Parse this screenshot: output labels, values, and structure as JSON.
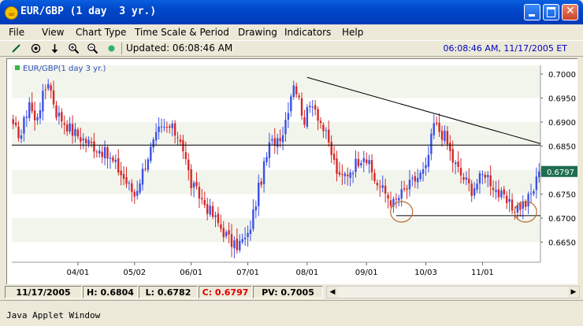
{
  "window": {
    "title": "EUR/GBP (1 day  3 yr.)",
    "app_icon": "java-coffee-icon"
  },
  "menu": [
    "File",
    "View",
    "Chart Type",
    "Time Scale & Period",
    "Drawing",
    "Indicators",
    "Help"
  ],
  "toolbar": {
    "icons": [
      "draw-line-icon",
      "crosshair-icon",
      "down-arrow-icon",
      "zoom-in-icon",
      "zoom-out-icon",
      "status-dot-icon"
    ],
    "updated": "Updated: 06:08:46 AM",
    "timestamp": "06:08:46 AM, 11/17/2005 ET"
  },
  "chart_data": {
    "type": "candlestick",
    "title": "EUR/GBP(1 day  3 yr.)",
    "y_ticks": [
      "0.7000",
      "0.6950",
      "0.6900",
      "0.6850",
      "0.6800",
      "0.6750",
      "0.6700",
      "0.6650"
    ],
    "y_tick_values": [
      0.7,
      0.695,
      0.69,
      0.685,
      0.68,
      0.675,
      0.67,
      0.665
    ],
    "x_ticks": [
      "04/01",
      "05/02",
      "06/01",
      "07/01",
      "08/01",
      "09/01",
      "10/03",
      "11/01"
    ],
    "x_tick_index": [
      24,
      45,
      66,
      87,
      109,
      131,
      153,
      174
    ],
    "ylim": [
      0.6608,
      0.7018
    ],
    "bar_count": 196,
    "current_price": "0.6797",
    "current_value": 0.6797,
    "up_color": "#3A50E8",
    "down_color": "#D52828",
    "anchors": [
      [
        0,
        0.6885
      ],
      [
        3,
        0.6875
      ],
      [
        6,
        0.6945
      ],
      [
        8,
        0.69
      ],
      [
        13,
        0.6988
      ],
      [
        16,
        0.692
      ],
      [
        22,
        0.688
      ],
      [
        27,
        0.686
      ],
      [
        33,
        0.684
      ],
      [
        38,
        0.681
      ],
      [
        45,
        0.6748
      ],
      [
        50,
        0.683
      ],
      [
        54,
        0.688
      ],
      [
        58,
        0.6888
      ],
      [
        62,
        0.6868
      ],
      [
        66,
        0.677
      ],
      [
        71,
        0.673
      ],
      [
        77,
        0.668
      ],
      [
        82,
        0.664
      ],
      [
        87,
        0.666
      ],
      [
        91,
        0.676
      ],
      [
        95,
        0.685
      ],
      [
        100,
        0.688
      ],
      [
        104,
        0.6985
      ],
      [
        108,
        0.6905
      ],
      [
        111,
        0.6945
      ],
      [
        116,
        0.687
      ],
      [
        121,
        0.678
      ],
      [
        125,
        0.68
      ],
      [
        130,
        0.6835
      ],
      [
        134,
        0.678
      ],
      [
        141,
        0.673
      ],
      [
        144,
        0.675
      ],
      [
        149,
        0.678
      ],
      [
        153,
        0.68
      ],
      [
        156,
        0.6895
      ],
      [
        160,
        0.687
      ],
      [
        163,
        0.682
      ],
      [
        166,
        0.679
      ],
      [
        170,
        0.676
      ],
      [
        175,
        0.6795
      ],
      [
        180,
        0.675
      ],
      [
        185,
        0.672
      ],
      [
        190,
        0.673
      ],
      [
        193,
        0.676
      ],
      [
        195,
        0.6797
      ]
    ],
    "drawings": [
      {
        "type": "trendline",
        "from": [
          109,
          0.6993
        ],
        "to": [
          196,
          0.6855
        ]
      },
      {
        "type": "horizontal",
        "value": 0.6852
      },
      {
        "type": "horizontal-segment",
        "from": [
          142,
          0.6705
        ],
        "to": [
          196,
          0.6705
        ]
      },
      {
        "type": "circle",
        "center": [
          144,
          0.6713
        ]
      },
      {
        "type": "circle",
        "center": [
          190,
          0.6713
        ]
      }
    ]
  },
  "status": {
    "date": "11/17/2005",
    "high": "H: 0.6804",
    "low": "L: 0.6782",
    "close": "C: 0.6797",
    "pv": "PV: 0.7005"
  },
  "colors": {
    "close": "#E00000",
    "timestamp": "#0000C0",
    "circle": "#B86A30",
    "price_label_bg": "#1E6E50"
  },
  "applet": "Java Applet Window"
}
